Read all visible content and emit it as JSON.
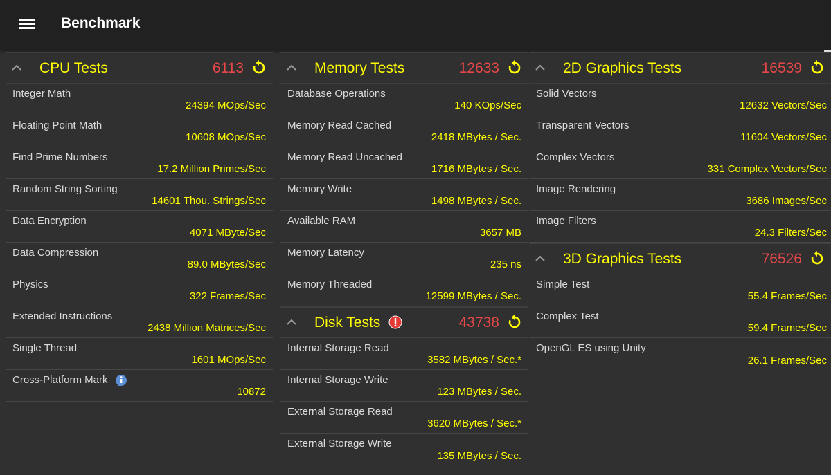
{
  "app": {
    "title": "Benchmark"
  },
  "colors": {
    "accent": "#ffff00",
    "score": "#e8474a",
    "background": "#303030",
    "appbar": "#212121"
  },
  "icons": {
    "menu": "menu-icon",
    "collapse": "chevron-up-icon",
    "refresh": "refresh-icon",
    "warning": "warning-icon",
    "info": "info-icon"
  },
  "cpu": {
    "title": "CPU Tests",
    "score": "6113",
    "rows": [
      {
        "label": "Integer Math",
        "value": "24394 MOps/Sec"
      },
      {
        "label": "Floating Point Math",
        "value": "10608 MOps/Sec"
      },
      {
        "label": "Find Prime Numbers",
        "value": "17.2 Million Primes/Sec"
      },
      {
        "label": "Random String Sorting",
        "value": "14601 Thou. Strings/Sec"
      },
      {
        "label": "Data Encryption",
        "value": "4071 MByte/Sec"
      },
      {
        "label": "Data Compression",
        "value": "89.0 MBytes/Sec"
      },
      {
        "label": "Physics",
        "value": "322 Frames/Sec"
      },
      {
        "label": "Extended Instructions",
        "value": "2438 Million Matrices/Sec"
      },
      {
        "label": "Single Thread",
        "value": "1601 MOps/Sec"
      },
      {
        "label": "Cross-Platform Mark",
        "value": "10872"
      }
    ]
  },
  "memory": {
    "title": "Memory Tests",
    "score": "12633",
    "rows": [
      {
        "label": "Database Operations",
        "value": "140 KOps/Sec"
      },
      {
        "label": "Memory Read Cached",
        "value": "2418 MBytes / Sec."
      },
      {
        "label": "Memory Read Uncached",
        "value": "1716 MBytes / Sec."
      },
      {
        "label": "Memory Write",
        "value": "1498 MBytes / Sec."
      },
      {
        "label": "Available RAM",
        "value": "3657 MB"
      },
      {
        "label": "Memory Latency",
        "value": "235 ns"
      },
      {
        "label": "Memory Threaded",
        "value": "12599 MBytes / Sec."
      }
    ]
  },
  "disk": {
    "title": "Disk Tests",
    "score": "43738",
    "rows": [
      {
        "label": "Internal Storage Read",
        "value": "3582 MBytes / Sec.*"
      },
      {
        "label": "Internal Storage Write",
        "value": "123 MBytes / Sec."
      },
      {
        "label": "External Storage Read",
        "value": "3620 MBytes / Sec.*"
      },
      {
        "label": "External Storage Write",
        "value": "135 MBytes / Sec."
      }
    ]
  },
  "g2d": {
    "title": "2D Graphics Tests",
    "score": "16539",
    "rows": [
      {
        "label": "Solid Vectors",
        "value": "12632 Vectors/Sec"
      },
      {
        "label": "Transparent Vectors",
        "value": "11604 Vectors/Sec"
      },
      {
        "label": "Complex Vectors",
        "value": "331 Complex Vectors/Sec"
      },
      {
        "label": "Image Rendering",
        "value": "3686 Images/Sec"
      },
      {
        "label": "Image Filters",
        "value": "24.3 Filters/Sec"
      }
    ]
  },
  "g3d": {
    "title": "3D Graphics Tests",
    "score": "76526",
    "rows": [
      {
        "label": "Simple Test",
        "value": "55.4 Frames/Sec"
      },
      {
        "label": "Complex Test",
        "value": "59.4 Frames/Sec"
      },
      {
        "label": "OpenGL ES using Unity",
        "value": "26.1 Frames/Sec"
      }
    ]
  }
}
